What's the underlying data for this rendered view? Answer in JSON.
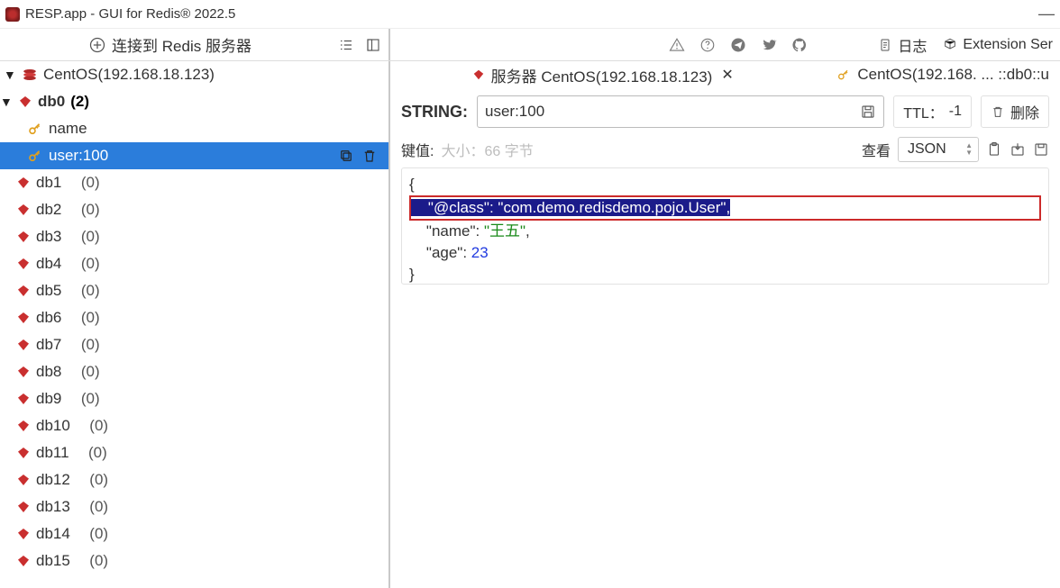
{
  "window": {
    "title": "RESP.app - GUI for Redis® 2022.5"
  },
  "toolbar": {
    "connect_label": "连接到 Redis 服务器",
    "log_label": "日志",
    "extension_label": "Extension Ser"
  },
  "sidebar": {
    "server": "CentOS(192.168.18.123)",
    "db0": {
      "name": "db0",
      "count": "(2)"
    },
    "keys": [
      {
        "name": "name",
        "selected": false
      },
      {
        "name": "user:100",
        "selected": true
      }
    ],
    "dbs": [
      {
        "name": "db1",
        "count": "(0)"
      },
      {
        "name": "db2",
        "count": "(0)"
      },
      {
        "name": "db3",
        "count": "(0)"
      },
      {
        "name": "db4",
        "count": "(0)"
      },
      {
        "name": "db5",
        "count": "(0)"
      },
      {
        "name": "db6",
        "count": "(0)"
      },
      {
        "name": "db7",
        "count": "(0)"
      },
      {
        "name": "db8",
        "count": "(0)"
      },
      {
        "name": "db9",
        "count": "(0)"
      },
      {
        "name": "db10",
        "count": "(0)"
      },
      {
        "name": "db11",
        "count": "(0)"
      },
      {
        "name": "db12",
        "count": "(0)"
      },
      {
        "name": "db13",
        "count": "(0)"
      },
      {
        "name": "db14",
        "count": "(0)"
      },
      {
        "name": "db15",
        "count": "(0)"
      }
    ]
  },
  "tabs": {
    "active": "服务器 CentOS(192.168.18.123)",
    "secondary": "CentOS(192.168. ... ::db0::u"
  },
  "key_view": {
    "type": "STRING:",
    "keyname": "user:100",
    "ttl_label": "TTL：",
    "ttl_value": "-1",
    "delete_label": "删除",
    "value_label": "键值:",
    "size_meta": "大小：66 字节",
    "view_label": "查看",
    "view_format": "JSON",
    "json": {
      "open": "{",
      "class_key": "\"@class\"",
      "class_sep": ": ",
      "class_val": "\"com.demo.redisdemo.pojo.User\"",
      "class_end": ",",
      "name_key": "\"name\"",
      "name_sep": ": ",
      "name_val": "\"王五\"",
      "name_end": ",",
      "age_key": "\"age\"",
      "age_sep": ": ",
      "age_val": "23",
      "close": "}"
    }
  }
}
